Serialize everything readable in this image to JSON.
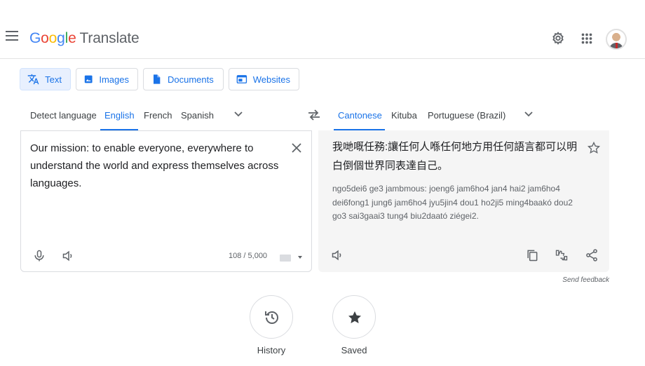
{
  "header": {
    "logo_google": [
      "G",
      "o",
      "o",
      "g",
      "l",
      "e"
    ],
    "product_name": "Translate",
    "icons": [
      "menu-icon",
      "settings-icon",
      "apps-icon",
      "avatar"
    ]
  },
  "modes": [
    {
      "label": "Text",
      "icon": "translate-icon",
      "active": true
    },
    {
      "label": "Images",
      "icon": "image-icon",
      "active": false
    },
    {
      "label": "Documents",
      "icon": "document-icon",
      "active": false
    },
    {
      "label": "Websites",
      "icon": "website-icon",
      "active": false
    }
  ],
  "source_langs": {
    "items": [
      "Detect language",
      "English",
      "French",
      "Spanish"
    ],
    "selected": "English"
  },
  "target_langs": {
    "items": [
      "Cantonese",
      "Kituba",
      "Portuguese (Brazil)"
    ],
    "selected": "Cantonese"
  },
  "source": {
    "text": "Our mission: to enable everyone, everywhere to understand the world and express themselves across languages.",
    "char_count": "108 / 5,000"
  },
  "target": {
    "text": "我哋嘅任務:讓任何人喺任何地方用任何語言都可以明白倒個世界同表達自己。",
    "transliteration": "ngo5dei6 ge3 jambmous: joeng6 jam6ho4 jan4 hai2 jam6ho4 dei6fong1 jung6 jam6ho4 jyu5jin4 dou1 ho2ji5 ming4baakó dou2 go3 sai3gaai3 tung4 biu2daató ziégei2."
  },
  "footer": {
    "send_feedback": "Send feedback",
    "history_label": "History",
    "saved_label": "Saved"
  },
  "colors": {
    "accent": "#1a73e8",
    "active_bg": "#e8f0fe",
    "target_panel_bg": "#f5f5f5"
  }
}
